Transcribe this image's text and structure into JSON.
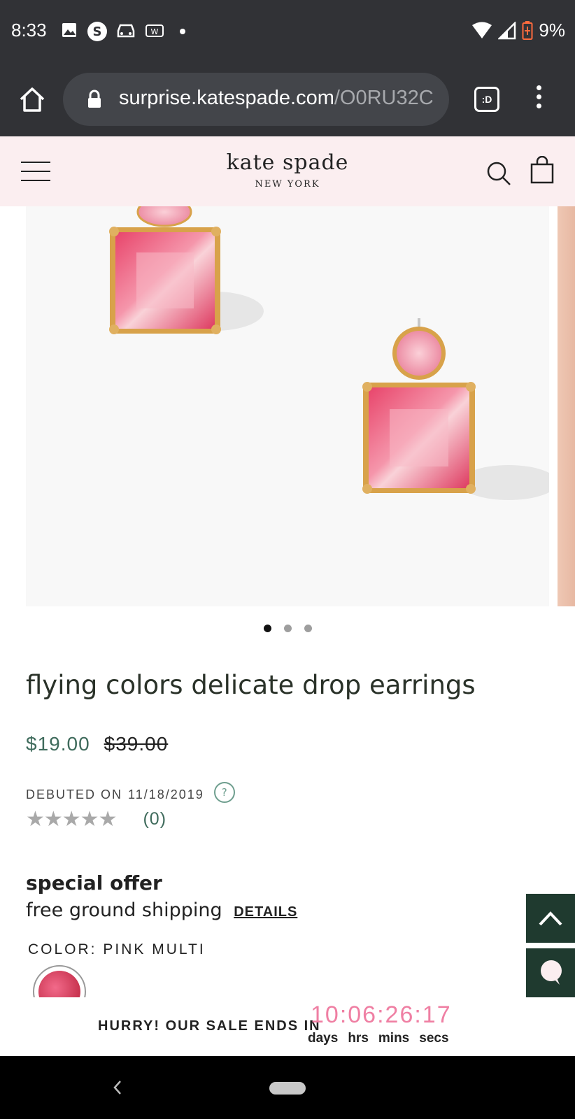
{
  "status_bar": {
    "time": "8:33",
    "battery": "9%",
    "icons": [
      "image-icon",
      "s-icon",
      "car-icon",
      "w-icon",
      "dot-icon",
      "wifi-icon",
      "signal-icon",
      "battery-icon"
    ]
  },
  "browser": {
    "url_host": "surprise.katespade.com",
    "url_path": "/O0RU32C",
    "tab_label": ":D"
  },
  "header": {
    "logo_main": "kate spade",
    "logo_sub": "NEW YORK"
  },
  "carousel": {
    "dots": 3,
    "active_index": 0
  },
  "product": {
    "title": "flying colors delicate drop earrings",
    "sale_price": "$19.00",
    "original_price": "$39.00",
    "debut_label": "DEBUTED ON",
    "debut_date": "11/18/2019",
    "help_glyph": "?",
    "stars": "★★★★★",
    "rating": 0,
    "review_count": "(0)",
    "offer_title": "special offer",
    "offer_text": "free ground shipping",
    "offer_link": "DETAILS",
    "color_label": "COLOR:",
    "color_value": "PINK MULTI"
  },
  "sale_banner": {
    "text": "HURRY! OUR SALE ENDS IN",
    "countdown": "10:06:26:17",
    "labels": [
      "days",
      "hrs",
      "mins",
      "secs"
    ]
  },
  "colors": {
    "status_bg": "#313236",
    "header_bg": "#fbeef0",
    "price_green": "#3f6b5c",
    "fab_green": "#1f3a2f",
    "countdown_pink": "#ef7fa3"
  }
}
